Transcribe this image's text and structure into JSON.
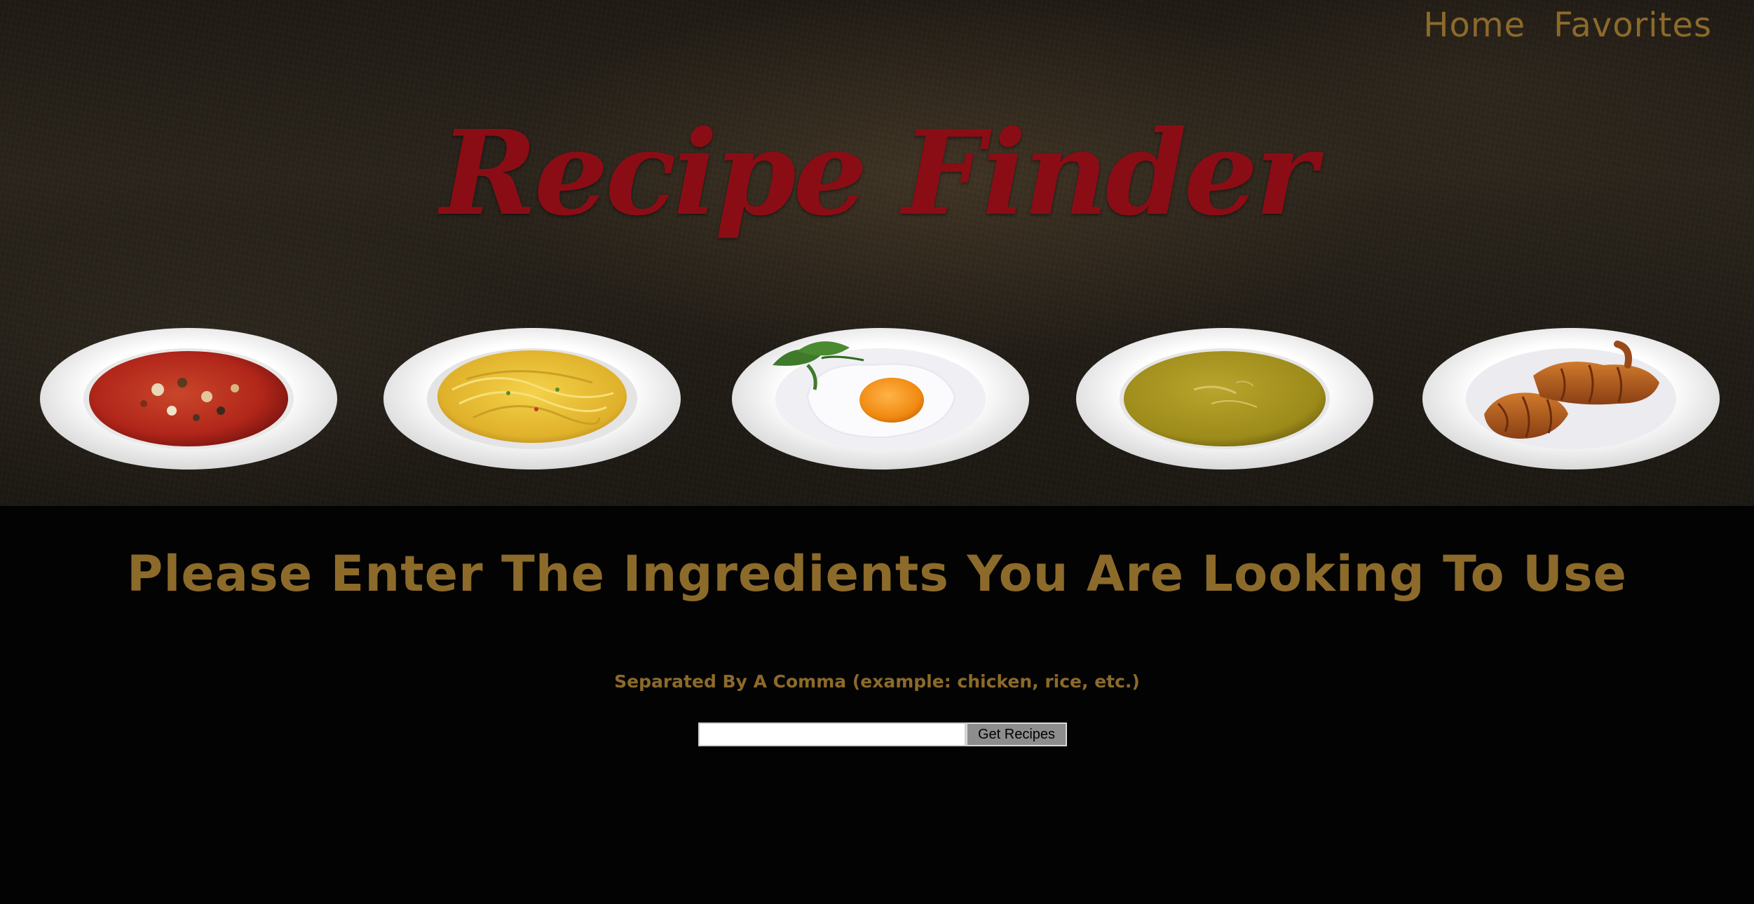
{
  "nav": {
    "home_label": "Home",
    "favorites_label": "Favorites"
  },
  "hero": {
    "title": "Recipe Finder",
    "plates": [
      {
        "icon": "tomato-soup-plate"
      },
      {
        "icon": "spaghetti-plate"
      },
      {
        "icon": "fried-egg-plate"
      },
      {
        "icon": "green-soup-plate"
      },
      {
        "icon": "croissant-plate"
      }
    ]
  },
  "prompt": {
    "heading": "Please Enter The Ingredients You Are Looking To Use",
    "subtext": "Separated By A Comma (example: chicken, rice, etc.)"
  },
  "search": {
    "input_value": "",
    "placeholder": "",
    "button_label": "Get Recipes"
  },
  "colors": {
    "accent_gold": "#8c6a2a",
    "title_red": "#8a0d16",
    "background": "#030303"
  }
}
